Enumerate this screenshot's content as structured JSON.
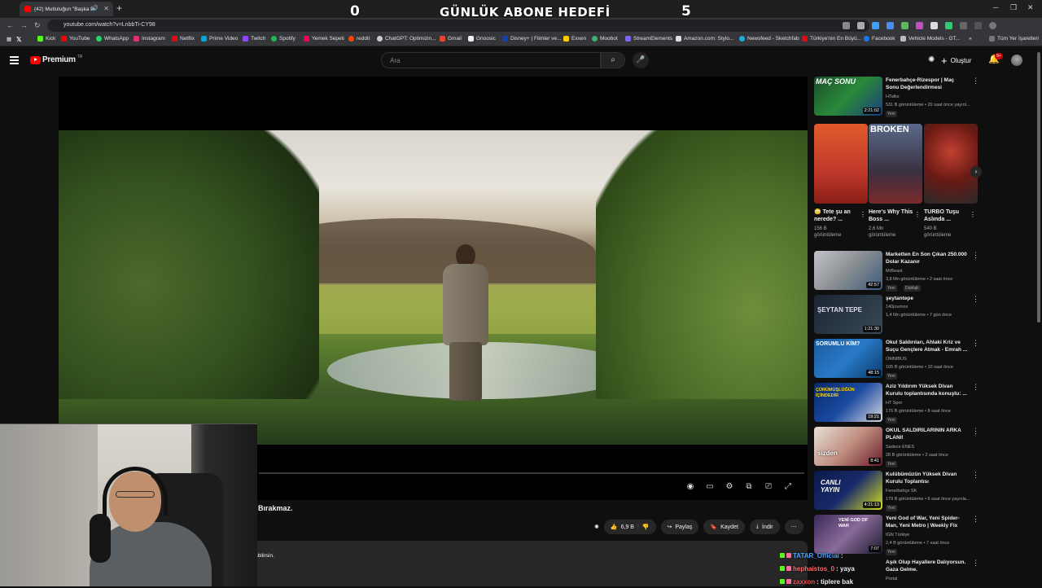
{
  "browser": {
    "tab_title": "(42) Mutluluğun \"Başka Bi",
    "url": "youtube.com/watch?v=LnbbTi-CY98",
    "bookmarks": [
      "Kick",
      "YouTube",
      "WhatsApp",
      "Instagram",
      "Netflix",
      "Prime Video",
      "Twitch",
      "Spotify",
      "Yemek Sepeti",
      "reddit",
      "ChatGPT: Optimizin...",
      "Gmail",
      "Gnoosic",
      "Disney+ | Filmler ve...",
      "Exxen",
      "Moobot",
      "StreamElements",
      "Amazon.com: Stylo...",
      "Newsfeed - Sketchfab",
      "Türkiye'nin En Büyü...",
      "Facebook",
      "Vehicle Models - GT..."
    ],
    "bookmarks_all": "Tüm Yer İşaretleri"
  },
  "overlay": {
    "left_num": "0",
    "title": "GÜNLÜK ABONE HEDEFİ",
    "right_num": "5"
  },
  "youtube": {
    "logo_text": "Premium",
    "logo_tr": "TR",
    "search_placeholder": "Ara",
    "create_label": "Oluştur",
    "notif_count": "9+"
  },
  "video": {
    "title_partial": "Bırakmaz.",
    "like_count": "6,9 B",
    "share_label": "Paylaş",
    "save_label": "Kaydet",
    "download_label": "İndir",
    "desc_partial": "r alabilirsin."
  },
  "recs_top": {
    "title": "Fenerbahçe-Rizespor | Maç Sonu Değerlendirmesi",
    "channel": "HTalks",
    "meta": "531 B görüntüleme • 20 saat önce yayınl...",
    "badge": "Yeni",
    "duration": "2:21:02",
    "thumb_text": "MAÇ SONU"
  },
  "shorts": [
    {
      "title": "Tete şu an nerede? ...",
      "views1": "156 B",
      "views2": "görüntüleme",
      "emoji": "😳"
    },
    {
      "title": "Here's Why This Boss ...",
      "views1": "2,6 Mn",
      "views2": "görüntüleme",
      "thumb_text": "BROKEN"
    },
    {
      "title": "TURBO Tuşu Aslında ...",
      "views1": "540 B",
      "views2": "görüntüleme"
    }
  ],
  "recs": [
    {
      "title": "Marketten En Son Çıkan 250.000 Dolar Kazanır",
      "channel": "MrBeast",
      "meta": "3,8 Mn görüntüleme • 2 saat önce",
      "badges": [
        "Yeni",
        "Dublajlı"
      ],
      "duration": "42:57"
    },
    {
      "title": "şeytantepe",
      "channel": "140journos",
      "meta": "1,4 Mn görüntüleme • 7 gün önce",
      "badges": [],
      "duration": "1:21:30",
      "thumb_text": "ŞEYTAN TEPE"
    },
    {
      "title": "Okul Saldırıları, Ahlaki Kriz ve Suçu Gençlere Atmak - Emrah ...",
      "channel": "OMNIBUS",
      "meta": "105 B görüntüleme • 10 saat önce",
      "badges": [
        "Yeni"
      ],
      "duration": "48:15",
      "thumb_text": "SORUMLU KİM?"
    },
    {
      "title": "Aziz Yıldırım Yüksek Divan Kurulu toplantısında konuştu: ...",
      "channel": "HT Spor",
      "meta": "176 B görüntüleme • 8 saat önce",
      "badges": [
        "Yeni"
      ],
      "duration": "19:21",
      "thumb_text": "ÇÜRÜMÜŞLÜĞÜN İÇİNDEDİR"
    },
    {
      "title": "OKUL SALDIRILARININ ARKA PLANI!",
      "channel": "Sadece ENES",
      "meta": "28 B görüntüleme • 2 saat önce",
      "badges": [
        "Yeni"
      ],
      "duration": "8:41",
      "thumb_text": "sizden"
    },
    {
      "title": "Kulübümüzün Yüksek Divan Kurulu Toplantısı",
      "channel": "Fenerbahçe SK",
      "meta": "179 B görüntüleme • 6 saat önce yayınla...",
      "badges": [
        "Yeni"
      ],
      "duration": "4:21:13",
      "thumb_text": "CANLI YAYIN"
    },
    {
      "title": "Yeni God of War, Yeni Spider-Man, Yeni Metro | Weekly Fix",
      "channel": "IGN Türkiye",
      "meta": "2,4 B görüntüleme • 7 saat önce",
      "badges": [
        "Yeni"
      ],
      "duration": "7:07",
      "thumb_text": "YENİ GOD OF WAR"
    },
    {
      "title": "Aşık Olup Hayallere Dalıyorsun. Gaza Gelme.",
      "channel": "Portal",
      "meta": "",
      "badges": [],
      "duration": ""
    }
  ],
  "chat": [
    {
      "user": "TATAR_Official",
      "msg": " :",
      "color": "#4fa3ff"
    },
    {
      "user": "hephaistos_0",
      "msg": " : yaya",
      "color": "#ff6b6b"
    },
    {
      "user": "zaxxon",
      "msg": " : tiplere bak",
      "color": "#ff4a4a"
    }
  ]
}
